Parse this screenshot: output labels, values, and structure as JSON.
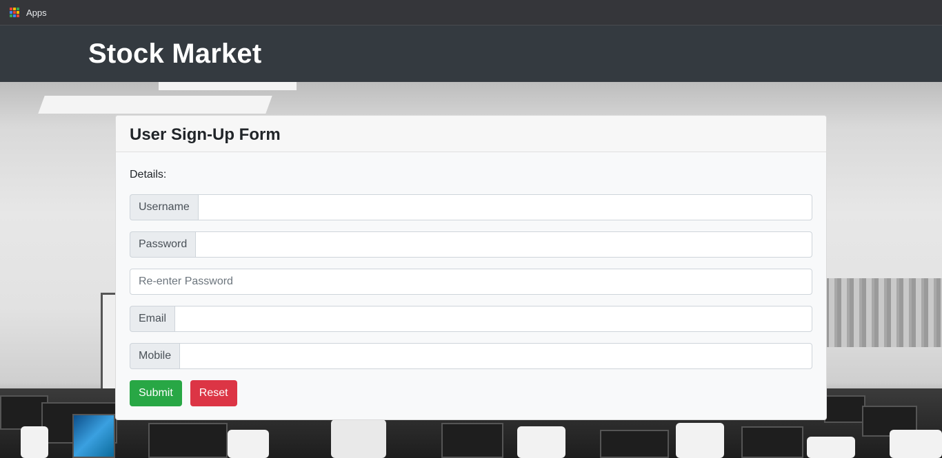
{
  "bookmarks": {
    "apps_label": "Apps"
  },
  "navbar": {
    "brand": "Stock Market"
  },
  "form": {
    "title": "User Sign-Up Form",
    "section_label": "Details:",
    "fields": {
      "username": {
        "label": "Username",
        "value": ""
      },
      "password": {
        "label": "Password",
        "value": ""
      },
      "reenter": {
        "placeholder": "Re-enter Password",
        "value": ""
      },
      "email": {
        "label": "Email",
        "value": ""
      },
      "mobile": {
        "label": "Mobile",
        "value": ""
      }
    },
    "buttons": {
      "submit": "Submit",
      "reset": "Reset"
    }
  },
  "colors": {
    "navbar": "#343a40",
    "submit": "#28a745",
    "reset": "#dc3545"
  }
}
